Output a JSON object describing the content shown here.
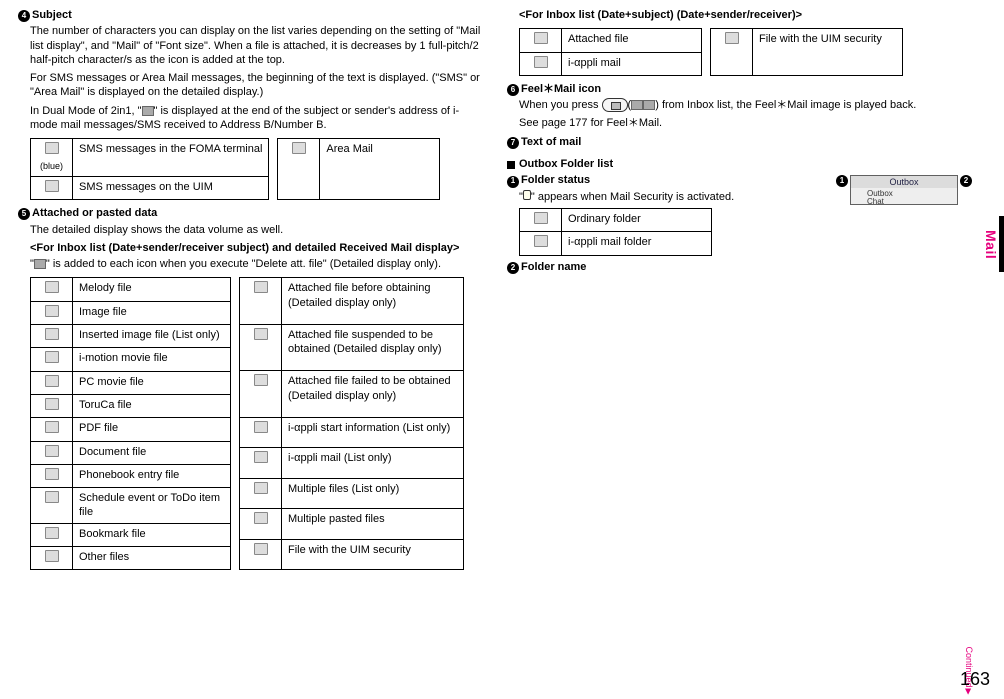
{
  "left": {
    "subject_num": "4",
    "subject_title": "Subject",
    "subject_p1": "The number of characters you can display on the list varies depending on the setting of \"Mail list display\", and \"Mail\" of \"Font size\". When a file is attached, it is decreases by 1 full-pitch/2 half-pitch character/s as the icon is added at the top.",
    "subject_p2": "For SMS messages or Area Mail messages, the beginning of the text is displayed. (\"SMS\" or \"Area Mail\" is displayed on the detailed display.)",
    "subject_p3_a": "In Dual Mode of 2in1, \"",
    "subject_p3_b": "\" is displayed at the end of the subject or sender's address of i-mode mail messages/SMS received to Address B/Number B.",
    "sms_blue_label": "(blue)",
    "sms_blue": "SMS messages in the FOMA terminal",
    "sms_uim": "SMS messages on the UIM",
    "area_mail": "Area Mail",
    "attached_num": "5",
    "attached_title": "Attached or pasted data",
    "attached_p1": "The detailed display shows the data volume as well.",
    "attached_sub": "<For Inbox list (Date+sender/receiver subject) and detailed Received Mail display>",
    "attached_p2_a": "\"",
    "attached_p2_b": "\" is added to each icon when you execute \"Delete att. file\" (Detailed display only).",
    "files_left": [
      "Melody file",
      "Image file",
      "Inserted image file (List only)",
      "i-motion movie file",
      "PC movie file",
      "ToruCa file",
      "PDF file",
      "Document file",
      "Phonebook entry file",
      "Schedule event or ToDo item file",
      "Bookmark file",
      "Other files"
    ],
    "files_right": [
      "Attached file before obtaining (Detailed display only)",
      "Attached file suspended to be obtained (Detailed display only)",
      "Attached file failed to be obtained (Detailed display only)",
      "i-αppli start information (List only)",
      "i-αppli mail (List only)",
      "Multiple files (List only)",
      "Multiple pasted files",
      "File with the UIM security"
    ]
  },
  "right": {
    "inbox_heading": "<For Inbox list (Date+subject) (Date+sender/receiver)>",
    "attached_file": "Attached file",
    "iappli_mail": "i-αppli mail",
    "file_uim": "File with the UIM security",
    "feel_num": "6",
    "feel_title": "Feel＊Mail icon",
    "feel_p_a": "When you press ",
    "feel_p_b": "(",
    "feel_p_c": ") from Inbox list, the Feel＊Mail image is played back.",
    "feel_p2": "See page 177 for Feel＊Mail.",
    "text_num": "7",
    "text_title": "Text of mail",
    "outbox_title": "Outbox Folder list",
    "folder_num": "1",
    "folder_title": "Folder status",
    "folder_p_a": "\"",
    "folder_p_b": "\" appears when Mail Security is activated.",
    "ordinary": "Ordinary folder",
    "iappli_folder": "i-αppli mail folder",
    "fname_num": "2",
    "fname_title": "Folder name",
    "screen_row1": "Outbox",
    "screen_row2": "Chat"
  },
  "side_label": "Mail",
  "continued": "Continued",
  "page_number": "163"
}
